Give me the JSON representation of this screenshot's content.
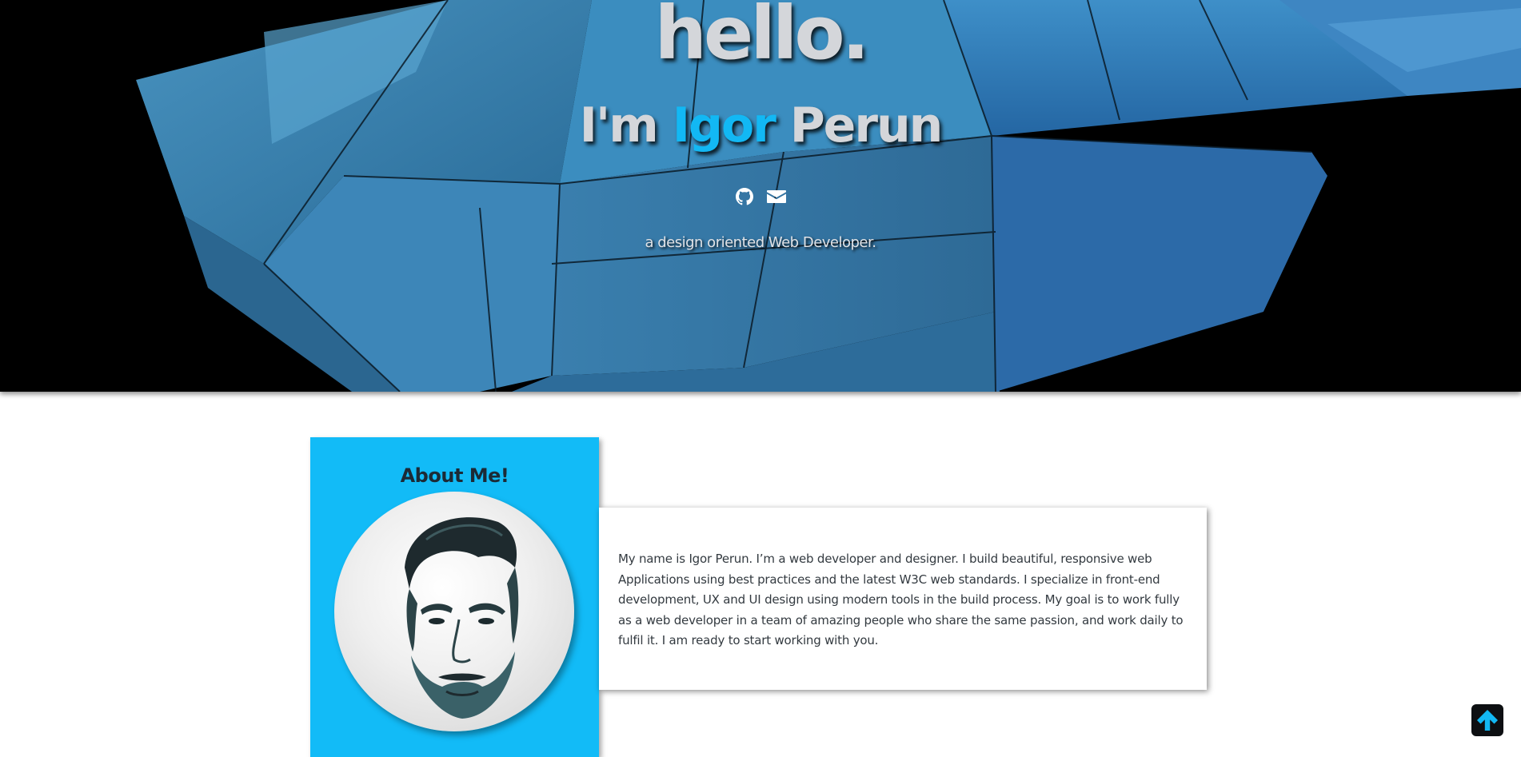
{
  "hero": {
    "greeting": "hello.",
    "name_prefix": "I'm ",
    "name_first": "Igor",
    "name_last": " Perun",
    "tagline": "a design oriented Web Developer.",
    "social": [
      {
        "icon": "github-icon"
      },
      {
        "icon": "envelope-icon"
      }
    ]
  },
  "about": {
    "title": "About Me!",
    "bio": "My name is Igor Perun. I’m a web developer and designer. I build beautiful, responsive web Applications using best practices and the latest W3C web standards. I specialize in front-end development, UX and UI design using modern tools in the build process. My goal is to work fully as a web developer in a team of amazing people who share the same passion, and work daily to fulfil it. I am ready to start working with you."
  },
  "back_to_top": {
    "icon": "arrow-up-icon"
  },
  "colors": {
    "accent": "#12b8f4",
    "card": "#12bbf7",
    "hero_glass": "#3d86b8",
    "back_to_top_bg": "#0d0f12"
  }
}
